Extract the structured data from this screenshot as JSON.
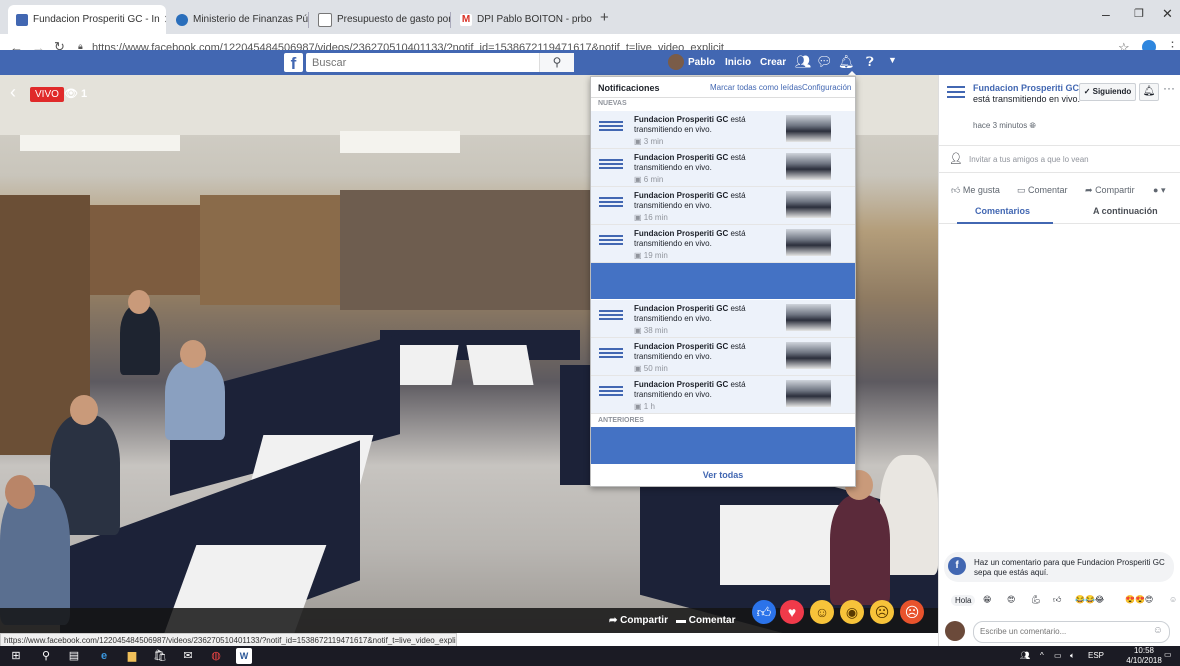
{
  "browser": {
    "tabs": [
      {
        "title": "Fundacion Prosperiti GC - In",
        "favicon_color": "#4267b2",
        "active": true
      },
      {
        "title": "Ministerio de Finanzas Públicas",
        "favicon_color": "#2a6ebb",
        "active": false
      },
      {
        "title": "Presupuesto de gasto por entidad",
        "favicon_color": "#777777",
        "active": false
      },
      {
        "title": "DPI Pablo BOITON - prboiton@g",
        "favicon_color": "#d93025",
        "active": false
      }
    ],
    "url": "https://www.facebook.com/122045484506987/videos/236270510401133/?notif_id=1538672119471617&notif_t=live_video_explicit"
  },
  "fb": {
    "search_placeholder": "Buscar",
    "user": "Pablo",
    "nav_home": "Inicio",
    "nav_create": "Crear"
  },
  "video": {
    "live_label": "VIVO",
    "viewers": "1",
    "share": "Compartir",
    "comment": "Comentar"
  },
  "status_url": "https://www.facebook.com/122045484506987/videos/236270510401133/?notif_id=1538672119471617&notif_t=live_video_explicit#",
  "notifications": {
    "title": "Notificaciones",
    "mark_all": "Marcar todas como leídas",
    "settings": "Configuración",
    "section_new": "NUEVAS",
    "section_old": "ANTERIORES",
    "see_all": "Ver todas",
    "items": [
      {
        "name": "Fundacion Prosperiti GC",
        "text": "está transmitiendo en vivo.",
        "time": "3 min"
      },
      {
        "name": "Fundacion Prosperiti GC",
        "text": "está transmitiendo en vivo.",
        "time": "6 min"
      },
      {
        "name": "Fundacion Prosperiti GC",
        "text": "está transmitiendo en vivo.",
        "time": "16 min"
      },
      {
        "name": "Fundacion Prosperiti GC",
        "text": "está transmitiendo en vivo.",
        "time": "19 min"
      },
      {
        "name": "Fundacion Prosperiti GC",
        "text": "está transmitiendo en vivo.",
        "time": "38 min"
      },
      {
        "name": "Fundacion Prosperiti GC",
        "text": "está transmitiendo en vivo.",
        "time": "50 min"
      },
      {
        "name": "Fundacion Prosperiti GC",
        "text": "está transmitiendo en vivo.",
        "time": "1 h"
      }
    ]
  },
  "panel": {
    "page_name": "Fundacion Prosperiti GC",
    "live_text": "está transmitiendo en vivo.",
    "time": "hace 3 minutos",
    "following": "Siguiendo",
    "invite": "Invitar a tus amigos a que lo vean",
    "like": "Me gusta",
    "comment": "Comentar",
    "share": "Compartir",
    "tab_comments": "Comentarios",
    "tab_next": "A continuación",
    "hint": "Haz un comentario para que Fundacion Prosperiti GC sepa que estás aquí.",
    "quick_hola": "Hola",
    "comment_placeholder": "Escribe un comentario..."
  },
  "taskbar": {
    "lang": "ESP",
    "time": "10:58",
    "date": "4/10/2018"
  }
}
